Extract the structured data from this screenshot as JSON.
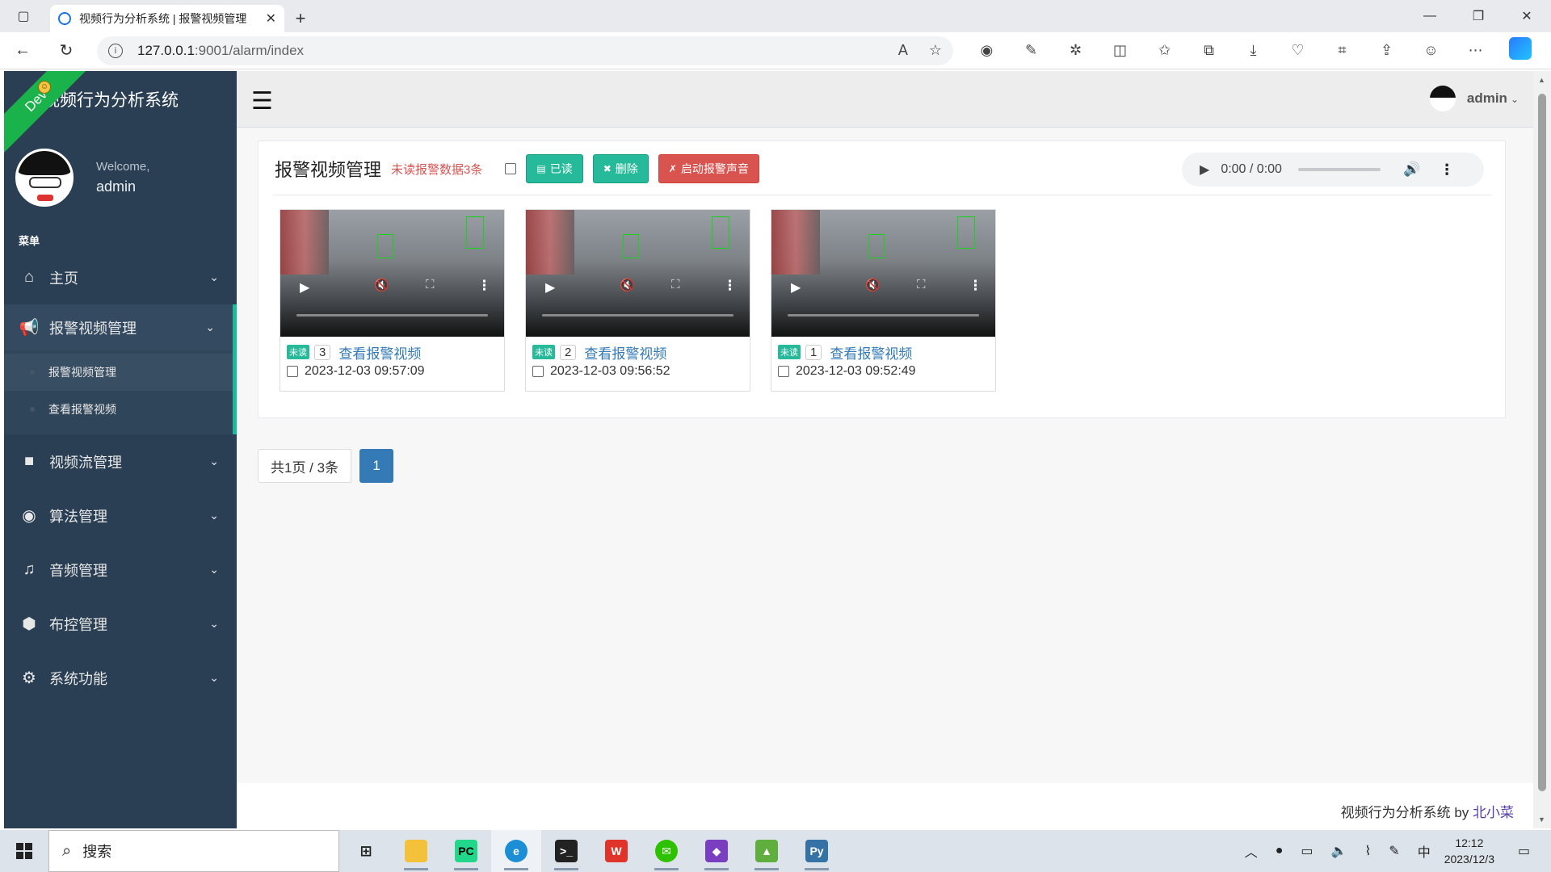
{
  "browser": {
    "tab_title": "视频行为分析系统 | 报警视频管理",
    "url_host": "127.0.0.1",
    "url_rest": ":9001/alarm/index"
  },
  "app": {
    "brand": "视频行为分析系统",
    "ribbon": "Dev",
    "welcome": "Welcome,",
    "username": "admin",
    "menu_title": "菜单",
    "menu": [
      {
        "label": "主页",
        "icon": "home-icon"
      },
      {
        "label": "报警视频管理",
        "icon": "bullhorn-icon"
      },
      {
        "label": "视频流管理",
        "icon": "video-camera-icon"
      },
      {
        "label": "算法管理",
        "icon": "eye-icon"
      },
      {
        "label": "音频管理",
        "icon": "music-icon"
      },
      {
        "label": "布控管理",
        "icon": "cube-icon"
      },
      {
        "label": "系统功能",
        "icon": "gear-icon"
      }
    ],
    "submenu": [
      {
        "label": "报警视频管理"
      },
      {
        "label": "查看报警视频"
      }
    ]
  },
  "topnav": {
    "user": "admin"
  },
  "panel": {
    "title": "报警视频管理",
    "unread_text": "未读报警数据3条",
    "btn_read": "已读",
    "btn_delete": "删除",
    "btn_sound": "启动报警声音",
    "audio_time": "0:00 / 0:00"
  },
  "cards": [
    {
      "badge": "未读",
      "num": "3",
      "link": "查看报警视频",
      "datetime": "2023-12-03 09:57:09"
    },
    {
      "badge": "未读",
      "num": "2",
      "link": "查看报警视频",
      "datetime": "2023-12-03 09:56:52"
    },
    {
      "badge": "未读",
      "num": "1",
      "link": "查看报警视频",
      "datetime": "2023-12-03 09:52:49"
    }
  ],
  "pager": {
    "info": "共1页 / 3条",
    "current": "1"
  },
  "footer": {
    "text": "视频行为分析系统 by ",
    "author": "北小菜"
  },
  "taskbar": {
    "search": "搜索",
    "ime": "中",
    "time": "12:12",
    "date": "2023/12/3"
  },
  "colors": {
    "sidebar": "#2a3f54",
    "accent_green": "#26b99a",
    "danger": "#d9534f",
    "link": "#337ab7"
  }
}
